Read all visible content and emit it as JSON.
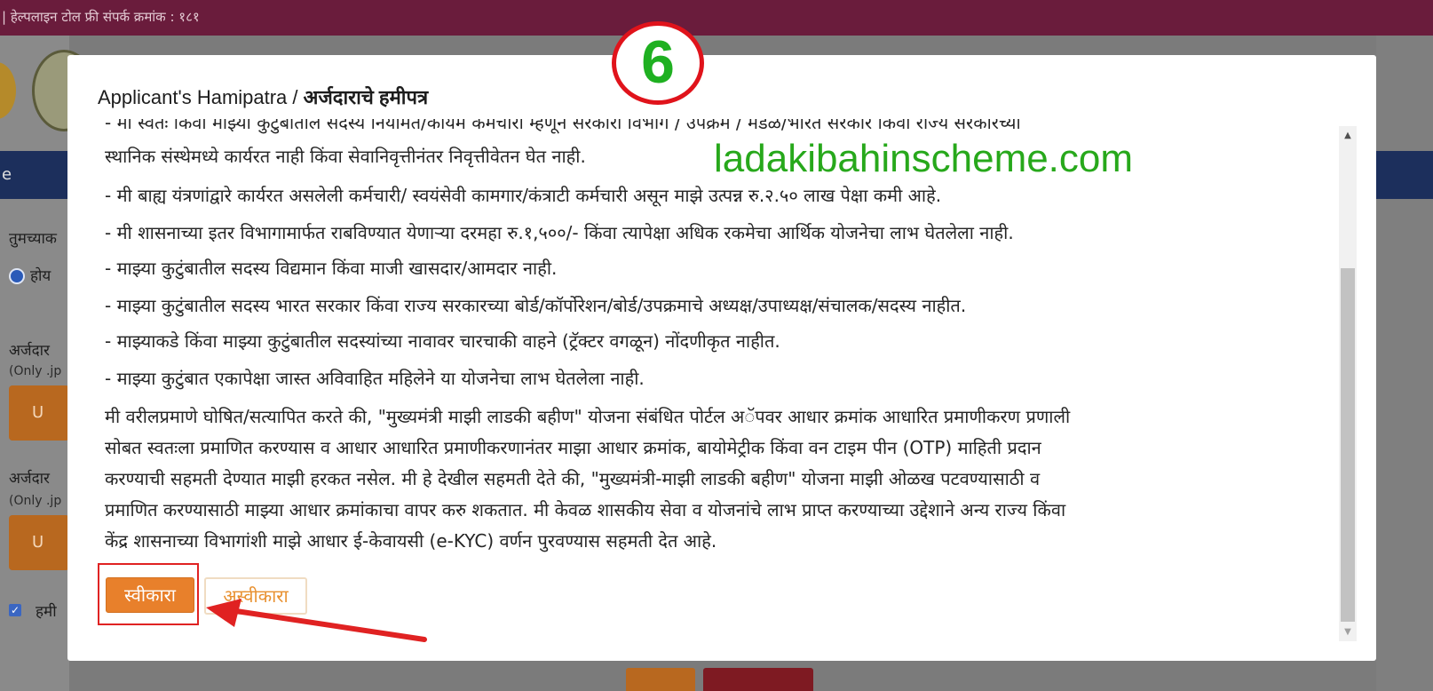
{
  "topbar": {
    "text": "| हेल्पलाइन टोल फ्री संपर्क क्रमांक : १८१"
  },
  "background": {
    "nav_text": "e",
    "label_1": "तुमच्याक",
    "radio_label": "होय",
    "label_2": "अर्जदार",
    "hint_2": "(Only .jp",
    "upload_1": "U",
    "label_3": "अर्जदार",
    "hint_3": "(Only .jp",
    "upload_2": "U",
    "checkbox_label": "हमी",
    "checkbox_mark": "✓"
  },
  "modal": {
    "title_en": "Applicant's Hamipatra / ",
    "title_mr": "अर्जदाराचे हमीपत्र",
    "lines": [
      "- मी स्वतः किंवा माझ्या कुटुंबातील सदस्य नियमित/कायम कर्मचारी म्हणून सरकारी विभाग / उपक्रम / मंडळ/भारत सरकार किंवा राज्य सरकारच्या",
      "स्थानिक संस्थेमध्ये कार्यरत नाही किंवा सेवानिवृत्तीनंतर निवृत्तीवेतन घेत नाही.",
      "- मी बाह्य यंत्रणांद्वारे कार्यरत असलेली कर्मचारी/ स्वयंसेवी कामगार/कंत्राटी कर्मचारी असून माझे उत्पन्न रु.२.५० लाख पेक्षा कमी आहे.",
      "- मी शासनाच्या इतर विभागामार्फत राबविण्यात येणाऱ्या दरमहा रु.१,५००/- किंवा त्यापेक्षा अधिक रकमेचा आर्थिक योजनेचा लाभ घेतलेला नाही.",
      "- माझ्या कुटुंबातील सदस्य विद्यमान किंवा माजी खासदार/आमदार नाही.",
      "- माझ्या कुटुंबातील सदस्य भारत सरकार किंवा राज्य सरकारच्या बोर्ड/कॉर्पोरेशन/बोर्ड/उपक्रमाचे अध्यक्ष/उपाध्यक्ष/संचालक/सदस्य नाहीत.",
      "- माझ्याकडे किंवा माझ्या कुटुंबातील सदस्यांच्या नावावर चारचाकी वाहने (ट्रॅक्टर वगळून) नोंदणीकृत नाहीत.",
      "- माझ्या कुटुंबात एकापेक्षा जास्त अविवाहित महिलेने या योजनेचा लाभ घेतलेला नाही."
    ],
    "declaration": [
      "मी वरीलप्रमाणे घोषित/सत्यापित करते की, \"मुख्यमंत्री माझी लाडकी बहीण\" योजना संबंधित पोर्टल अॅपवर आधार क्रमांक आधारित प्रमाणीकरण प्रणाली",
      "सोबत स्वतःला प्रमाणित करण्यास व आधार आधारित प्रमाणीकरणानंतर माझा आधार क्रमांक, बायोमेट्रीक किंवा वन टाइम पीन (OTP) माहिती प्रदान",
      "करण्याची सहमती देण्यात माझी हरकत नसेल. मी हे देखील सहमती देते की, \"मुख्यमंत्री-माझी लाडकी बहीण\" योजना माझी ओळख पटवण्यासाठी व",
      "प्रमाणित करण्यासाठी माझ्या आधार क्रमांकाचा वापर करु शकतात. मी केवळ शासकीय सेवा व योजनांचे लाभ प्राप्त करण्याच्या उद्देशाने अन्य राज्य किंवा",
      "केंद्र शासनाच्या विभागांशी माझे आधार ई-केवायसी (e-KYC) वर्णन पुरवण्यास सहमती देत आहे."
    ],
    "accept_label": "स्वीकारा",
    "reject_label": "अस्वीकारा"
  },
  "overlay": {
    "step_number": "6",
    "watermark": "ladakibahinscheme.com"
  },
  "colors": {
    "topbar": "#6a1c3c",
    "accent_orange": "#e8802b",
    "annotation_red": "#e02222",
    "watermark_green": "#27a81b"
  }
}
